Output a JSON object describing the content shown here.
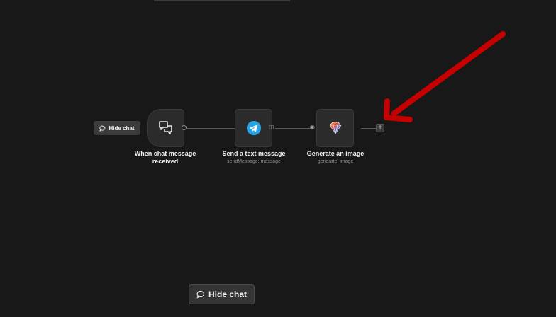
{
  "canvas": {
    "hide_chat_small_label": "Hide chat",
    "hide_chat_button_label": "Hide chat"
  },
  "nodes": [
    {
      "title": "When chat message received",
      "subtitle": "",
      "icon": "chat-bubbles-icon"
    },
    {
      "title": "Send a text message",
      "subtitle": "sendMessage: message",
      "icon": "telegram-icon"
    },
    {
      "title": "Generate an image",
      "subtitle": "generate: image",
      "icon": "gemini-icon"
    }
  ],
  "add_node": {
    "symbol": "+"
  },
  "colors": {
    "background": "#181818",
    "node_bg": "#2b2b2b",
    "annotation_arrow": "#c40000",
    "telegram_blue": "#2aa3e0"
  }
}
